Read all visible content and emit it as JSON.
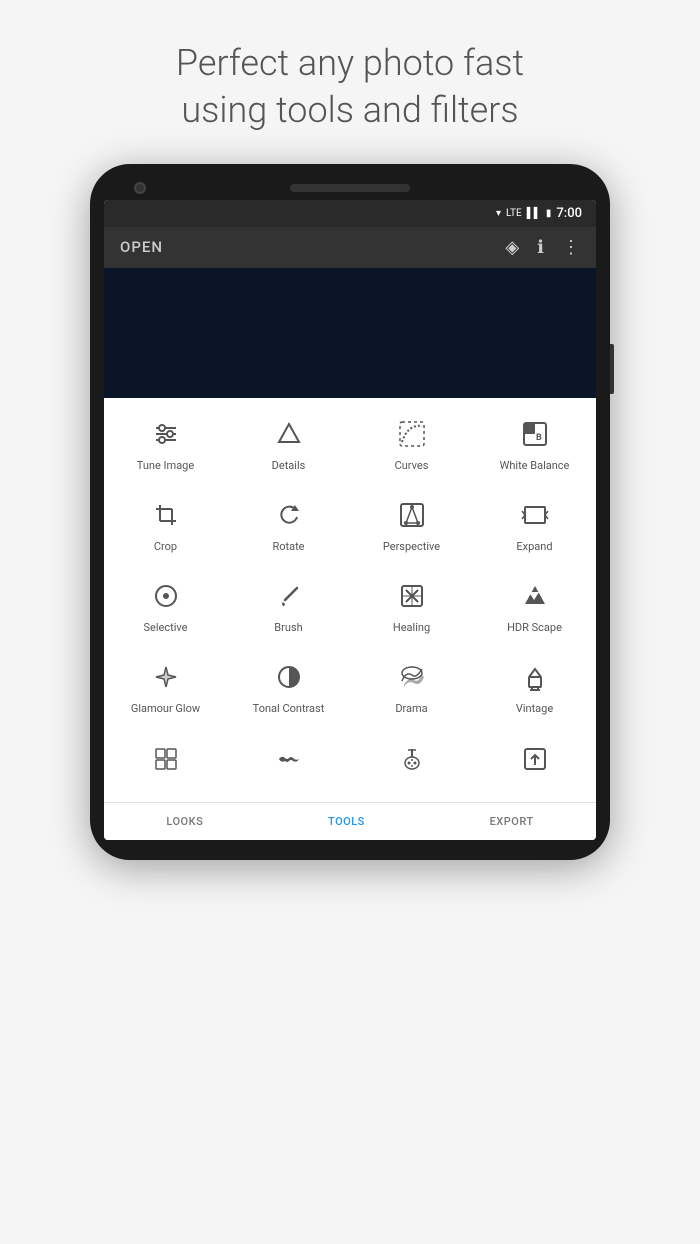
{
  "headline": {
    "line1": "Perfect any photo fast",
    "line2": "using tools and filters"
  },
  "statusBar": {
    "time": "7:00",
    "icons": [
      "▾",
      "LTE",
      "▌",
      "🔋"
    ]
  },
  "toolbar": {
    "openLabel": "OPEN",
    "icons": [
      "layers",
      "info",
      "more"
    ]
  },
  "tools": [
    {
      "id": "tune-image",
      "icon": "⊞",
      "iconSymbol": "≡⃝",
      "label": "Tune Image"
    },
    {
      "id": "details",
      "icon": "▽",
      "label": "Details"
    },
    {
      "id": "curves",
      "icon": "⌒",
      "label": "Curves"
    },
    {
      "id": "white-balance",
      "icon": "WB",
      "label": "White Balance"
    },
    {
      "id": "crop",
      "icon": "⊡",
      "label": "Crop"
    },
    {
      "id": "rotate",
      "icon": "↻",
      "label": "Rotate"
    },
    {
      "id": "perspective",
      "icon": "⬡",
      "label": "Perspective"
    },
    {
      "id": "expand",
      "icon": "⬜",
      "label": "Expand"
    },
    {
      "id": "selective",
      "icon": "◎",
      "label": "Selective"
    },
    {
      "id": "brush",
      "icon": "∕",
      "label": "Brush"
    },
    {
      "id": "healing",
      "icon": "✕",
      "label": "Healing"
    },
    {
      "id": "hdr-scape",
      "icon": "▲",
      "label": "HDR Scape"
    },
    {
      "id": "glamour-glow",
      "icon": "◇",
      "label": "Glamour\nGlow"
    },
    {
      "id": "tonal-contrast",
      "icon": "◐",
      "label": "Tonal\nContrast"
    },
    {
      "id": "drama",
      "icon": "☁",
      "label": "Drama"
    },
    {
      "id": "vintage",
      "icon": "⌂",
      "label": "Vintage"
    },
    {
      "id": "looks",
      "icon": "⊞",
      "label": ""
    },
    {
      "id": "looks-label",
      "icon": "",
      "label": ""
    },
    {
      "id": "tools-label",
      "icon": "",
      "label": ""
    },
    {
      "id": "export-label",
      "icon": "",
      "label": ""
    }
  ],
  "bottomNav": [
    {
      "id": "looks",
      "icon": "⊞",
      "label": "LOOKS",
      "active": false
    },
    {
      "id": "tools",
      "icon": "🔧",
      "label": "TOOLS",
      "active": true
    },
    {
      "id": "export",
      "icon": "⬜",
      "label": "EXPORT",
      "active": false
    }
  ],
  "colors": {
    "activeNavColor": "#2196F3",
    "inactiveNavColor": "#777777",
    "toolIconColor": "#555555",
    "screenBg": "#ffffff",
    "photoBg": "#0a1628"
  }
}
